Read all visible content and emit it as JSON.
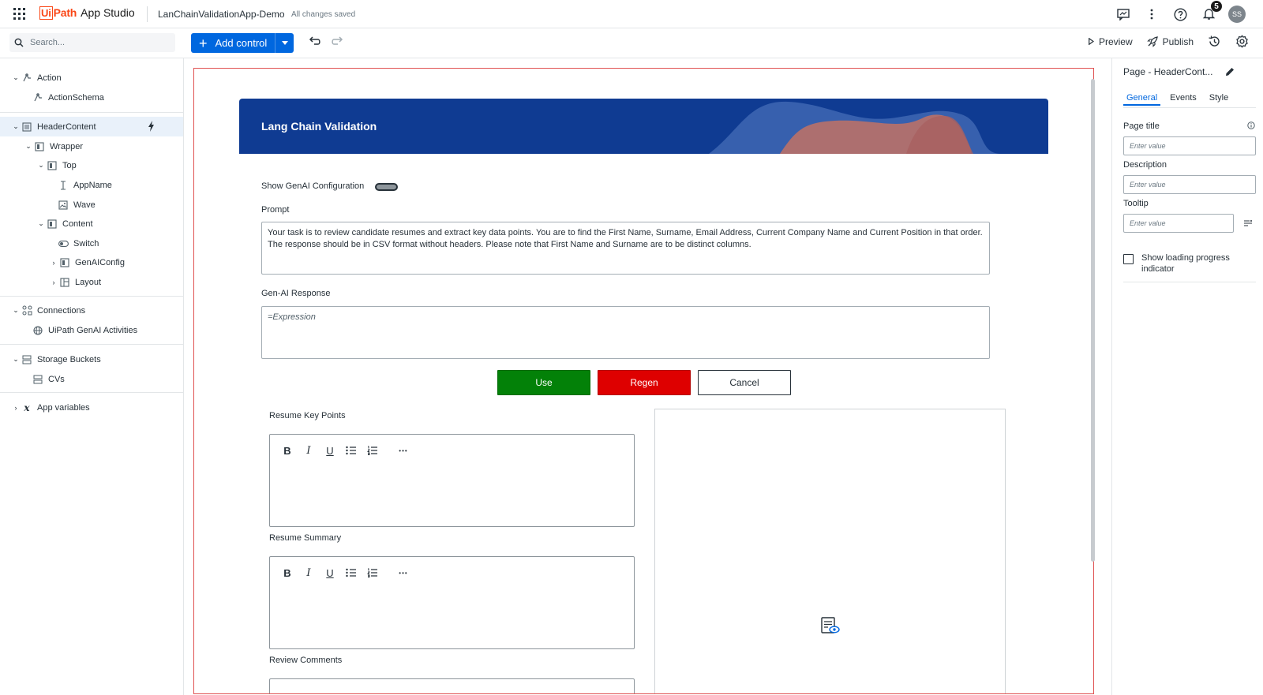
{
  "app": {
    "brand_left": "Ui",
    "brand_right": "Path",
    "product": "App Studio",
    "project_name": "LanChainValidationApp-Demo",
    "save_status": "All changes saved",
    "notifications_count": "5",
    "user_initials": "SS"
  },
  "toolbar": {
    "search_placeholder": "Search...",
    "add_control_label": "Add control",
    "preview_label": "Preview",
    "publish_label": "Publish"
  },
  "tree": {
    "action": "Action",
    "action_schema": "ActionSchema",
    "header_content": "HeaderContent",
    "wrapper": "Wrapper",
    "top": "Top",
    "app_name": "AppName",
    "wave": "Wave",
    "content": "Content",
    "switch": "Switch",
    "genai_config": "GenAIConfig",
    "layout": "Layout",
    "connections": "Connections",
    "genai_activities": "UiPath GenAI Activities",
    "storage_buckets": "Storage Buckets",
    "cvs": "CVs",
    "app_variables": "App variables"
  },
  "canvas": {
    "header_title": "Lang Chain Validation",
    "toggle_label": "Show GenAI Configuration",
    "prompt_label": "Prompt",
    "prompt_text": "Your task is to review candidate resumes and extract key data points. You are to find the First Name, Surname, Email Address, Current Company Name and Current Position in that order.  The response should be in CSV format without headers.  Please note that First Name and Surname are to be distinct columns.",
    "response_label": "Gen-AI Response",
    "response_value": "=Expression",
    "use_label": "Use",
    "regen_label": "Regen",
    "cancel_label": "Cancel",
    "key_points_label": "Resume Key Points",
    "summary_label": "Resume Summary",
    "comments_label": "Review Comments",
    "rte_more": "•••"
  },
  "properties": {
    "title": "Page - HeaderCont...",
    "tab_general": "General",
    "tab_events": "Events",
    "tab_style": "Style",
    "page_title_label": "Page title",
    "description_label": "Description",
    "tooltip_label": "Tooltip",
    "input_placeholder": "Enter value",
    "loading_label": "Show loading progress indicator"
  },
  "colors": {
    "accent": "#0067df",
    "header_bg": "#0f3b92",
    "use_btn": "#038108",
    "regen_btn": "#de0000",
    "canvas_border": "#e05252"
  }
}
